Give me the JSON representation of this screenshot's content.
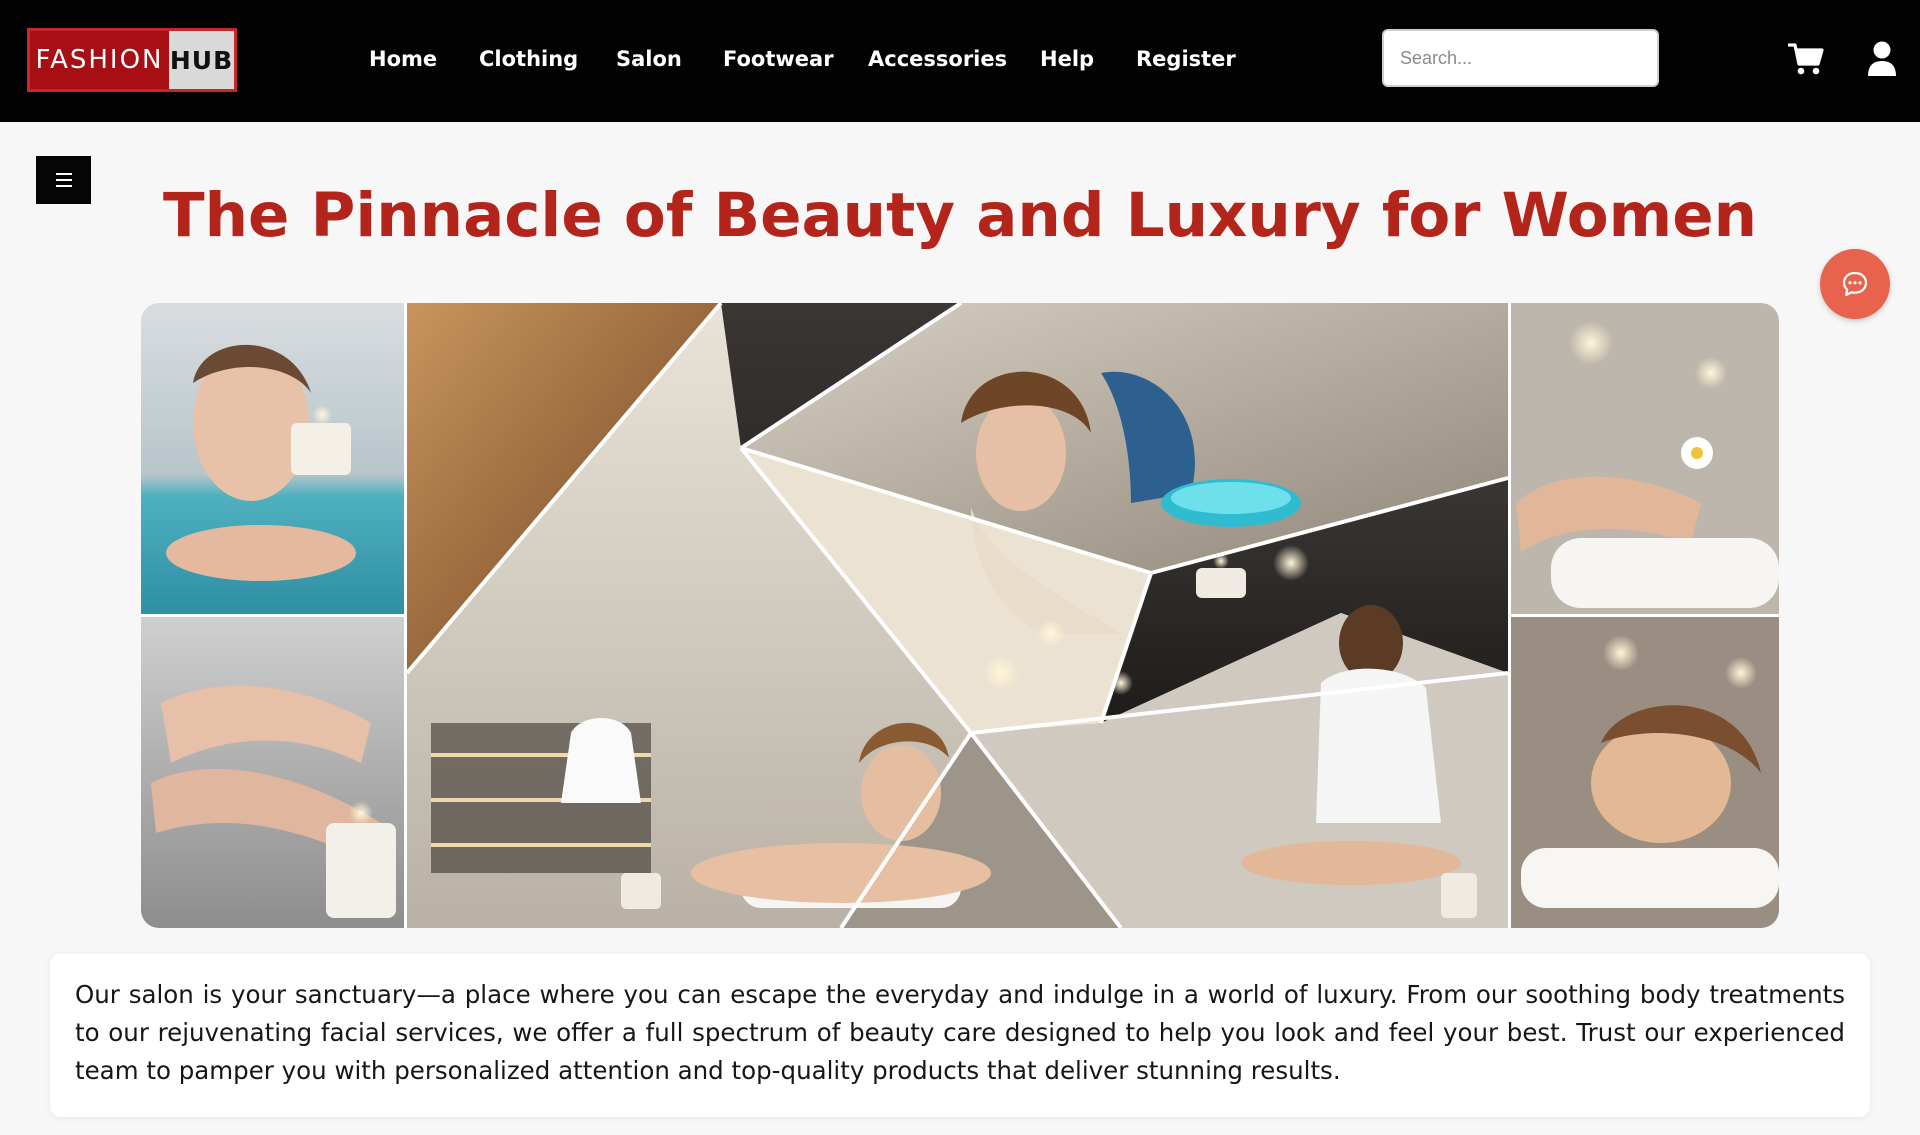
{
  "header": {
    "logo": {
      "part1": "FASHION",
      "part2": "HUB"
    },
    "nav": [
      {
        "label": "Home"
      },
      {
        "label": "Clothing"
      },
      {
        "label": "Salon"
      },
      {
        "label": "Footwear"
      },
      {
        "label": "Accessories"
      },
      {
        "label": "Help"
      },
      {
        "label": "Register"
      }
    ],
    "search": {
      "placeholder": "Search...",
      "value": ""
    },
    "icons": {
      "cart": "cart-icon",
      "user": "user-icon"
    }
  },
  "main": {
    "menu_icon": "hamburger-menu-icon",
    "title": "The Pinnacle of Beauty and Luxury for Women",
    "chat_icon": "chat-bubble-icon",
    "collage": {
      "panels": [
        "woman relaxing in spa water",
        "manicured hands on a towel",
        "hands combing long hair",
        "woman meditating among salon shelves",
        "stylist styling a woman's hair",
        "woman relaxing with eyes closed",
        "facial treatment with spa stones",
        "therapist giving a head massage",
        "hand massage with a flower",
        "woman resting on a towel"
      ]
    },
    "description": "Our salon is your sanctuary—a place where you can escape the everyday and indulge in a world of luxury. From our soothing body treatments to our rejuvenating facial services, we offer a full spectrum of beauty care designed to help you look and feel your best. Trust our experienced team to pamper you with personalized attention and top-quality products that deliver stunning results."
  },
  "colors": {
    "header_bg": "#020202",
    "accent": "#b3241b",
    "logo_red": "#a80f14",
    "chat_button": "#e8634d",
    "page_bg": "#f7f7f7"
  }
}
